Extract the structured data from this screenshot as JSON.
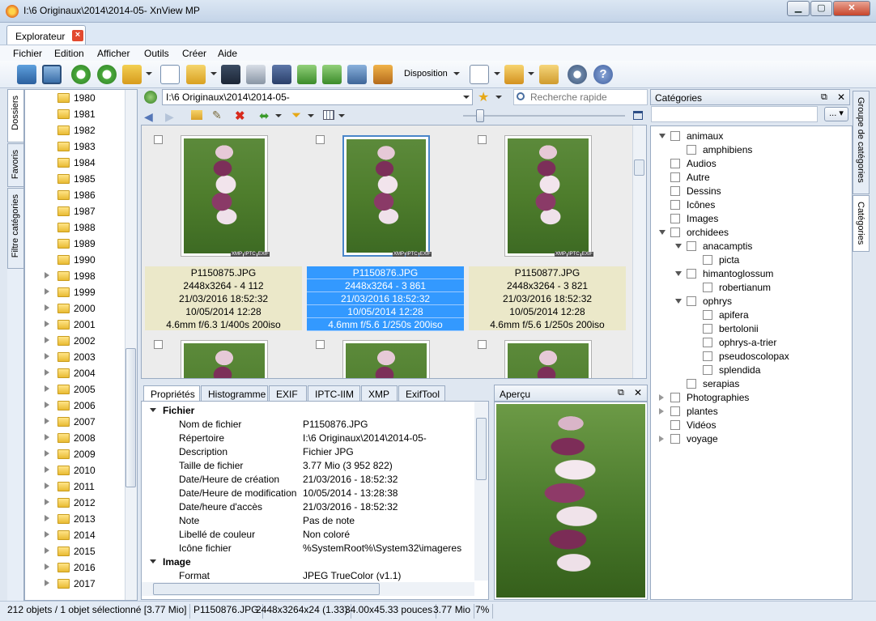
{
  "window": {
    "title": "I:\\6 Originaux\\2014\\2014-05- XnView MP",
    "min": "▁",
    "max": "▢",
    "close": "✕"
  },
  "tabs": [
    {
      "label": "Explorateur"
    }
  ],
  "menu": [
    "Fichier",
    "Edition",
    "Afficher",
    "Outils",
    "Créer",
    "Aide"
  ],
  "toolbar": {
    "disposition": "Disposition"
  },
  "left_tabs": [
    "Dossiers",
    "Favoris",
    "Filtre catégories"
  ],
  "folders": [
    {
      "name": "1980",
      "arrow": false
    },
    {
      "name": "1981",
      "arrow": false
    },
    {
      "name": "1982",
      "arrow": false
    },
    {
      "name": "1983",
      "arrow": false
    },
    {
      "name": "1984",
      "arrow": false
    },
    {
      "name": "1985",
      "arrow": false
    },
    {
      "name": "1986",
      "arrow": false
    },
    {
      "name": "1987",
      "arrow": false
    },
    {
      "name": "1988",
      "arrow": false
    },
    {
      "name": "1989",
      "arrow": false
    },
    {
      "name": "1990",
      "arrow": false
    },
    {
      "name": "1998",
      "arrow": true
    },
    {
      "name": "1999",
      "arrow": true
    },
    {
      "name": "2000",
      "arrow": true
    },
    {
      "name": "2001",
      "arrow": true
    },
    {
      "name": "2002",
      "arrow": true
    },
    {
      "name": "2003",
      "arrow": true
    },
    {
      "name": "2004",
      "arrow": true
    },
    {
      "name": "2005",
      "arrow": true
    },
    {
      "name": "2006",
      "arrow": true
    },
    {
      "name": "2007",
      "arrow": true
    },
    {
      "name": "2008",
      "arrow": true
    },
    {
      "name": "2009",
      "arrow": true
    },
    {
      "name": "2010",
      "arrow": true
    },
    {
      "name": "2011",
      "arrow": true
    },
    {
      "name": "2012",
      "arrow": true
    },
    {
      "name": "2013",
      "arrow": true
    },
    {
      "name": "2014",
      "arrow": true
    },
    {
      "name": "2015",
      "arrow": true
    },
    {
      "name": "2016",
      "arrow": true
    },
    {
      "name": "2017",
      "arrow": true
    }
  ],
  "path": {
    "value": "I:\\6 Originaux\\2014\\2014-05-",
    "search_placeholder": "Recherche rapide"
  },
  "thumbnails": [
    {
      "name": "P1150875.JPG",
      "size": "2448x3264 - 4 112",
      "created": "21/03/2016 18:52:32",
      "modified": "10/05/2014 12:28",
      "exif": "4.6mm f/6.3 1/400s 200iso",
      "selected": false
    },
    {
      "name": "P1150876.JPG",
      "size": "2448x3264 - 3 861",
      "created": "21/03/2016 18:52:32",
      "modified": "10/05/2014 12:28",
      "exif": "4.6mm f/5.6 1/250s 200iso",
      "selected": true
    },
    {
      "name": "P1150877.JPG",
      "size": "2448x3264 - 3 821",
      "created": "21/03/2016 18:52:32",
      "modified": "10/05/2014 12:28",
      "exif": "4.6mm f/5.6 1/250s 200iso",
      "selected": false
    }
  ],
  "badges": [
    "XMP",
    "IPTC",
    "EXIF"
  ],
  "prop_tabs": [
    "Propriétés",
    "Histogramme",
    "EXIF",
    "IPTC-IIM",
    "XMP",
    "ExifTool"
  ],
  "properties": [
    {
      "section": true,
      "key": "Fichier",
      "value": ""
    },
    {
      "key": "Nom de fichier",
      "value": "P1150876.JPG"
    },
    {
      "key": "Répertoire",
      "value": "I:\\6 Originaux\\2014\\2014-05-"
    },
    {
      "key": "Description",
      "value": "Fichier JPG"
    },
    {
      "key": "Taille de fichier",
      "value": "3.77 Mio (3 952 822)"
    },
    {
      "key": "Date/Heure de création",
      "value": "21/03/2016 - 18:52:32"
    },
    {
      "key": "Date/Heure de modification",
      "value": "10/05/2014 - 13:28:38"
    },
    {
      "key": "Date/heure d'accès",
      "value": "21/03/2016 - 18:52:32"
    },
    {
      "key": "Note",
      "value": "Pas de note"
    },
    {
      "key": "Libellé de couleur",
      "value": "Non coloré"
    },
    {
      "key": "Icône fichier",
      "value": "%SystemRoot%\\System32\\imageres"
    },
    {
      "section": true,
      "key": "Image",
      "value": ""
    },
    {
      "key": "Format",
      "value": "JPEG TrueColor (v1.1)"
    }
  ],
  "apercu": {
    "title": "Aperçu"
  },
  "categories": {
    "title": "Catégories",
    "more": "...",
    "items": [
      {
        "label": "animaux",
        "indent": 0,
        "arrow": "open"
      },
      {
        "label": "amphibiens",
        "indent": 1,
        "arrow": "none"
      },
      {
        "label": "Audios",
        "indent": 0,
        "arrow": "none"
      },
      {
        "label": "Autre",
        "indent": 0,
        "arrow": "none"
      },
      {
        "label": "Dessins",
        "indent": 0,
        "arrow": "none"
      },
      {
        "label": "Icônes",
        "indent": 0,
        "arrow": "none"
      },
      {
        "label": "Images",
        "indent": 0,
        "arrow": "none"
      },
      {
        "label": "orchidees",
        "indent": 0,
        "arrow": "open"
      },
      {
        "label": "anacamptis",
        "indent": 1,
        "arrow": "open"
      },
      {
        "label": "picta",
        "indent": 2,
        "arrow": "none"
      },
      {
        "label": "himantoglossum",
        "indent": 1,
        "arrow": "open"
      },
      {
        "label": "robertianum",
        "indent": 2,
        "arrow": "none"
      },
      {
        "label": "ophrys",
        "indent": 1,
        "arrow": "open"
      },
      {
        "label": "apifera",
        "indent": 2,
        "arrow": "none"
      },
      {
        "label": "bertolonii",
        "indent": 2,
        "arrow": "none"
      },
      {
        "label": "ophrys-a-trier",
        "indent": 2,
        "arrow": "none"
      },
      {
        "label": "pseudoscolopax",
        "indent": 2,
        "arrow": "none"
      },
      {
        "label": "splendida",
        "indent": 2,
        "arrow": "none"
      },
      {
        "label": "serapias",
        "indent": 1,
        "arrow": "none"
      },
      {
        "label": "Photographies",
        "indent": 0,
        "arrow": "closed"
      },
      {
        "label": "plantes",
        "indent": 0,
        "arrow": "closed"
      },
      {
        "label": "Vidéos",
        "indent": 0,
        "arrow": "none"
      },
      {
        "label": "voyage",
        "indent": 0,
        "arrow": "closed"
      }
    ]
  },
  "right_tabs": [
    "Groupe de catégories",
    "Catégories"
  ],
  "status": [
    "212 objets / 1 objet sélectionné [3.77 Mio]",
    "P1150876.JPG",
    "2448x3264x24 (1.33)",
    "34.00x45.33 pouces",
    "3.77 Mio",
    "7%"
  ]
}
